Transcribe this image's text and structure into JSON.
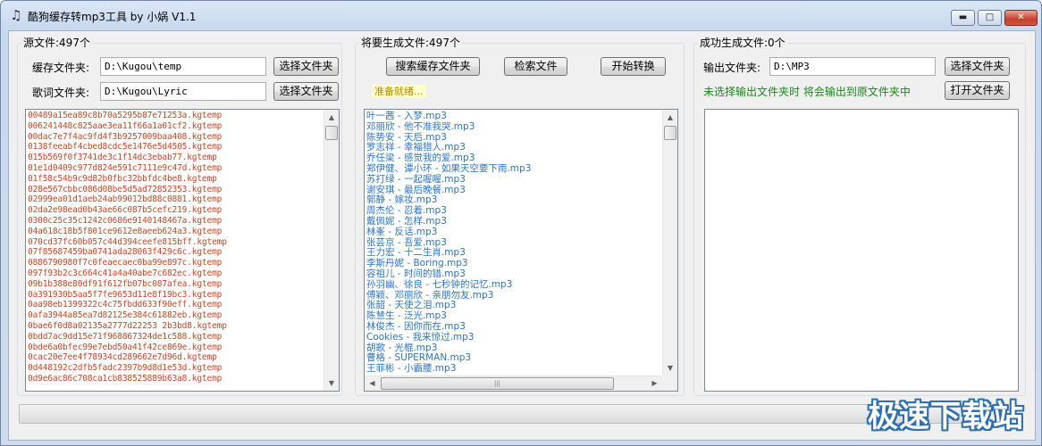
{
  "window": {
    "title": "酷狗缓存转mp3工具 by 小娲 V1.1",
    "app_icon": "music-note-icon",
    "controls": {
      "minimize": "minimize-icon",
      "maximize": "maximize-icon",
      "close": "close-icon"
    }
  },
  "source": {
    "title": "源文件:497个",
    "cache_label": "缓存文件夹:",
    "cache_value": "D:\\Kugou\\temp",
    "lyric_label": "歌词文件夹:",
    "lyric_value": "D:\\Kugou\\Lyric",
    "choose_button": "选择文件夹",
    "files": [
      "00489a15ea89c8b70a5295b87e71253a.kgtemp",
      "006241448c825aae3ea11f66a1a01cf2.kgtemp",
      "00dac7e7f4ac9fd4f3b9257009baa408.kgtemp",
      "0138feeabf4cbed8cdc5e1476e5d4505.kgtemp",
      "015b569f0f3741de3c1f14dc3ebab77.kgtemp",
      "01e1d0409c977d824e591c7111e9c47d.kgtemp",
      "01f58c54b9c9d82b0fbc32bbfdc4be8.kgtemp",
      "028e567cbbc086d08be5d5ad72852353.kgtemp",
      "02999ea01d1aeb24ab99012bd88c0881.kgtemp",
      "02da2e98ead0b43ae66c087b5cefc219.kgtemp",
      "0300c25c35c1242c0686e9140148467a.kgtemp",
      "04a618c18b5f801ce9612e8aeeb624a3.kgtemp",
      "070cd37fc60b057c44d394ceefe815bff.kgtemp",
      "07f85687459ba0741ada28063f429c6c.kgtemp",
      "0886790980f7c0feaecaec0ba99e897c.kgtemp",
      "097f93b2c3c664c41a4a40abe7c682ec.kgtemp",
      "09b1b388e80df91f612fb07bc087afea.kgtemp",
      "0a391930b5aa5f7fe9653d11e8f19bc3.kgtemp",
      "0aa98eb1399322c4c75fbdd633f90eff.kgtemp",
      "0afa3944a85ea7d82125e384c61882eb.kgtemp",
      "0bae6f0d8a02135a2777d22253 2b3bd8.kgtemp",
      "0bdd7ac9dd15e71f968867324de1c588.kgtemp",
      "0bde6a0bfec99e7ebd50a41f42ce869e.kgtemp",
      "0cac20e7ee4f78934cd289662e7d96d.kgtemp",
      "0d448192c2dfb5fadc2397b9d8d1e53d.kgtemp",
      "0d9e6ac86c708ca1cb838525889b63a8.kgtemp"
    ]
  },
  "generate": {
    "title": "将要生成文件:497个",
    "search_cache_button": "搜索缓存文件夹",
    "search_file_button": "检索文件",
    "start_button": "开始转换",
    "status": "准备就绪...",
    "files": [
      "叶一茜 - 入梦.mp3",
      "邓丽欣 - 他不准我哭.mp3",
      "陈势安 - 天后.mp3",
      "罗志祥 - 幸福猎人.mp3",
      "乔任梁 - 感觉我的爱.mp3",
      "郑伊健、谭小环 - 如果天空要下雨.mp3",
      "苏打绿 - 一起喔喔.mp3",
      "谢安琪 - 最后晚餐.mp3",
      "郭静 - 嫁妆.mp3",
      "周杰伦 - 忍着.mp3",
      "戴佩妮 - 怎样.mp3",
      "林峯 - 反话.mp3",
      "张芸京 - 吾爱.mp3",
      "王力宏 - 十二生肖.mp3",
      "李斯丹妮 - Boring.mp3",
      "容祖儿 - 时间的错.mp3",
      "孙羽幽、徐良 - 七秒钟的记忆.mp3",
      "傅颖、邓丽欣 - 亲朋勿友.mp3",
      "张韶 - 天使之泪.mp3",
      "陈慧生 - 泛光.mp3",
      "林俊杰 - 因你而在.mp3",
      "Cookies - 我来惊过.mp3",
      "胡歌 - 光棍.mp3",
      "曹格 - SUPERMAN.mp3",
      "王菲彬 - 小霸腰.mp3"
    ]
  },
  "output": {
    "title": "成功生成文件:0个",
    "folder_label": "输出文件夹:",
    "folder_value": "D:\\MP3",
    "choose_button": "选择文件夹",
    "open_button": "打开文件夹",
    "note": "未选择输出文件夹时 将会输出到原文件夹中"
  },
  "progress": {
    "fraction": 0.0
  },
  "watermark": "极速下载站"
}
